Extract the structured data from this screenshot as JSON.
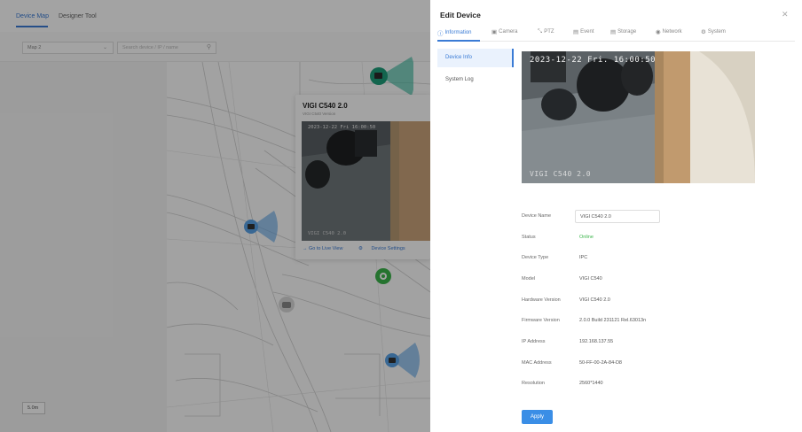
{
  "background": {
    "tabs": [
      "Device Map",
      "Designer Tool"
    ],
    "map_select": "Map 2",
    "search_placeholder": "Search device / IP / name",
    "scale_label": "5.0m",
    "popup": {
      "title": "VIGI C540 2.0",
      "subtitle": "VIGI C540 Version",
      "timestamp": "2023-12-22 Fri 16:00:50",
      "camera_overlay": "VIGI C540 2.0",
      "action_live": "Go to Live View",
      "action_settings": "Device Settings"
    }
  },
  "drawer": {
    "title": "Edit Device",
    "tabs": [
      {
        "label": "Information",
        "icon": "info-icon"
      },
      {
        "label": "Camera",
        "icon": "camera-icon"
      },
      {
        "label": "PTZ",
        "icon": "ptz-icon"
      },
      {
        "label": "Event",
        "icon": "event-icon"
      },
      {
        "label": "Storage",
        "icon": "storage-icon"
      },
      {
        "label": "Network",
        "icon": "network-icon"
      },
      {
        "label": "System",
        "icon": "system-icon"
      }
    ],
    "side_menu": [
      "Device Info",
      "System Log"
    ],
    "preview": {
      "timestamp": "2023-12-22 Fri. 16:00:50",
      "overlay": "VIGI C540 2.0"
    },
    "info": [
      {
        "label": "Device Name",
        "value": "VIGI C540 2.0"
      },
      {
        "label": "Status",
        "value": "Online"
      },
      {
        "label": "Device Type",
        "value": "IPC"
      },
      {
        "label": "Model",
        "value": "VIGI C540"
      },
      {
        "label": "Hardware Version",
        "value": "VIGI C540 2.0"
      },
      {
        "label": "Firmware Version",
        "value": "2.0.0 Build 231121 Rel.63013n"
      },
      {
        "label": "IP Address",
        "value": "192.168.137.55"
      },
      {
        "label": "MAC Address",
        "value": "50-FF-00-2A-84-D8"
      },
      {
        "label": "Resolution",
        "value": "2560*1440"
      }
    ],
    "apply_label": "Apply"
  },
  "colors": {
    "accent": "#3a7bd5",
    "online": "#3bb54a",
    "camera_fov": "#2fb59a"
  }
}
